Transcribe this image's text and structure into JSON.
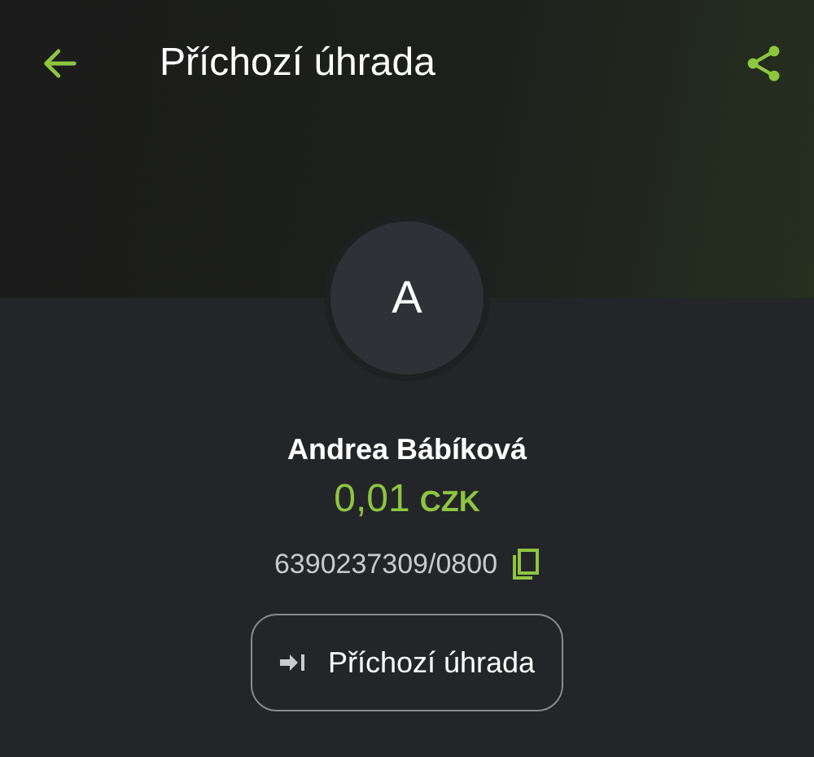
{
  "app_bar": {
    "title": "Příchozí úhrada"
  },
  "avatar": {
    "initial": "A"
  },
  "counterparty": {
    "name": "Andrea Bábíková",
    "amount": "0,01",
    "currency": "CZK",
    "account": "6390237309/0800"
  },
  "type_button": {
    "label": "Příchozí úhrada"
  }
}
